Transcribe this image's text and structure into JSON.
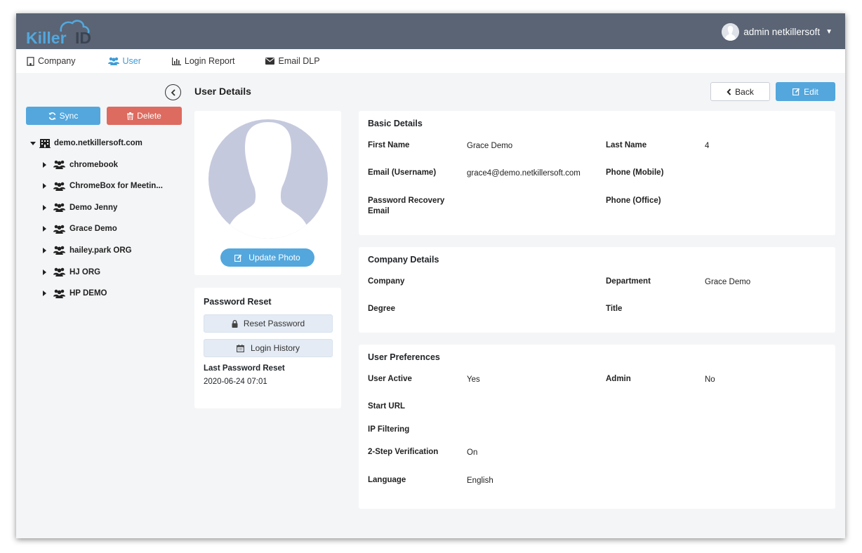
{
  "app": {
    "logo_text": "Killer ID",
    "user_name": "admin netkillersoft",
    "colors": {
      "topbar": "#5a6474",
      "accent": "#3d9bd7",
      "primary_button": "#53a7dd",
      "danger_button": "#dd6b5f",
      "background": "#f4f5f7"
    }
  },
  "nav": {
    "items": [
      {
        "label": "Company",
        "icon": "building-icon",
        "active": false
      },
      {
        "label": "User",
        "icon": "users-icon",
        "active": true
      },
      {
        "label": "Login Report",
        "icon": "bar-chart-icon",
        "active": false
      },
      {
        "label": "Email DLP",
        "icon": "envelope-icon",
        "active": false
      }
    ]
  },
  "sidebar": {
    "sync_label": "Sync",
    "delete_label": "Delete",
    "tree": {
      "root": "demo.netkillersoft.com",
      "children": [
        "chromebook",
        "ChromeBox for Meetin...",
        "Demo Jenny",
        "Grace Demo",
        "hailey.park ORG",
        "HJ ORG",
        "HP DEMO"
      ]
    }
  },
  "page": {
    "title": "User Details",
    "back_label": "Back",
    "edit_label": "Edit"
  },
  "photo_card": {
    "update_photo_label": "Update Photo"
  },
  "password_card": {
    "title": "Password Reset",
    "reset_label": "Reset Password",
    "history_label": "Login History",
    "last_reset_label": "Last Password Reset",
    "last_reset_value": "2020-06-24 07:01"
  },
  "basic": {
    "title": "Basic Details",
    "first_name_label": "First Name",
    "first_name": "Grace Demo",
    "last_name_label": "Last Name",
    "last_name": "4",
    "email_label": "Email (Username)",
    "email": "grace4@demo.netkillersoft.com",
    "phone_mobile_label": "Phone (Mobile)",
    "phone_mobile": "",
    "recovery_label_1": "Password Recovery",
    "recovery_label_2": "Email",
    "recovery_email": "",
    "phone_office_label": "Phone (Office)",
    "phone_office": ""
  },
  "company": {
    "title": "Company Details",
    "company_label": "Company",
    "company": "",
    "department_label": "Department",
    "department": "Grace Demo",
    "degree_label": "Degree",
    "degree": "",
    "title_label": "Title",
    "job_title": ""
  },
  "prefs": {
    "title": "User Preferences",
    "active_label": "User Active",
    "active": "Yes",
    "admin_label": "Admin",
    "admin": "No",
    "start_url_label": "Start URL",
    "start_url": "",
    "ip_filter_label": "IP Filtering",
    "ip_filter": "",
    "two_step_label": "2-Step Verification",
    "two_step": "On",
    "language_label": "Language",
    "language": "English"
  }
}
